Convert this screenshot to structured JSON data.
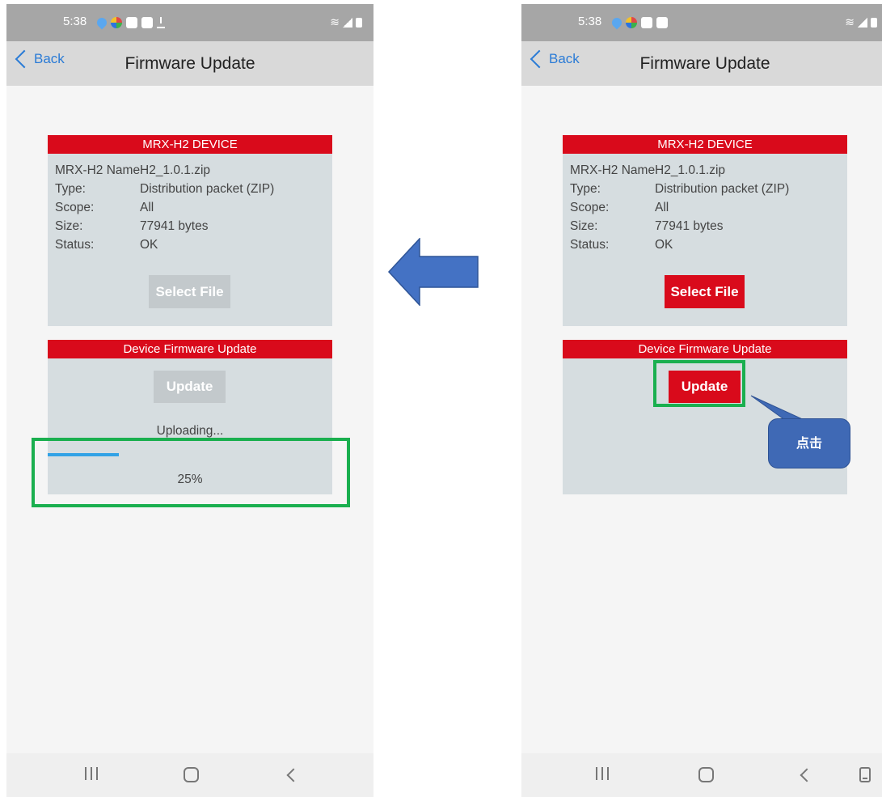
{
  "left_screen": {
    "status": {
      "time": "5:38"
    },
    "nav": {
      "back_label": "Back",
      "title": "Firmware Update"
    },
    "device_card": {
      "header": "MRX-H2 DEVICE",
      "rows": [
        {
          "key": "MRX-H2 Name",
          "value": "H2_1.0.1.zip"
        },
        {
          "key": "Type:",
          "value": "Distribution packet (ZIP)"
        },
        {
          "key": "Scope:",
          "value": "All"
        },
        {
          "key": "Size:",
          "value": "77941 bytes"
        },
        {
          "key": "Status:",
          "value": "OK"
        }
      ],
      "select_button": "Select File"
    },
    "dfu_card": {
      "header": "Device Firmware Update",
      "update_button": "Update",
      "status_text": "Uploading...",
      "progress_percent": 25,
      "progress_label": "25%"
    }
  },
  "right_screen": {
    "status": {
      "time": "5:38"
    },
    "nav": {
      "back_label": "Back",
      "title": "Firmware Update"
    },
    "device_card": {
      "header": "MRX-H2 DEVICE",
      "rows": [
        {
          "key": "MRX-H2 Name",
          "value": "H2_1.0.1.zip"
        },
        {
          "key": "Type:",
          "value": "Distribution packet (ZIP)"
        },
        {
          "key": "Scope:",
          "value": "All"
        },
        {
          "key": "Size:",
          "value": "77941 bytes"
        },
        {
          "key": "Status:",
          "value": "OK"
        }
      ],
      "select_button": "Select File"
    },
    "dfu_card": {
      "header": "Device Firmware Update",
      "update_button": "Update"
    }
  },
  "annotations": {
    "callout_text": "点击",
    "arrow_direction": "left",
    "arrow_color": "#4472c4",
    "highlight_color": "#1aaf4f"
  },
  "colors": {
    "accent_red": "#d90a1b",
    "card_bg": "#d6dde0",
    "disabled_button": "#c3c9cc",
    "progress_blue": "#32a2e6",
    "link_blue": "#2a7bd6"
  }
}
